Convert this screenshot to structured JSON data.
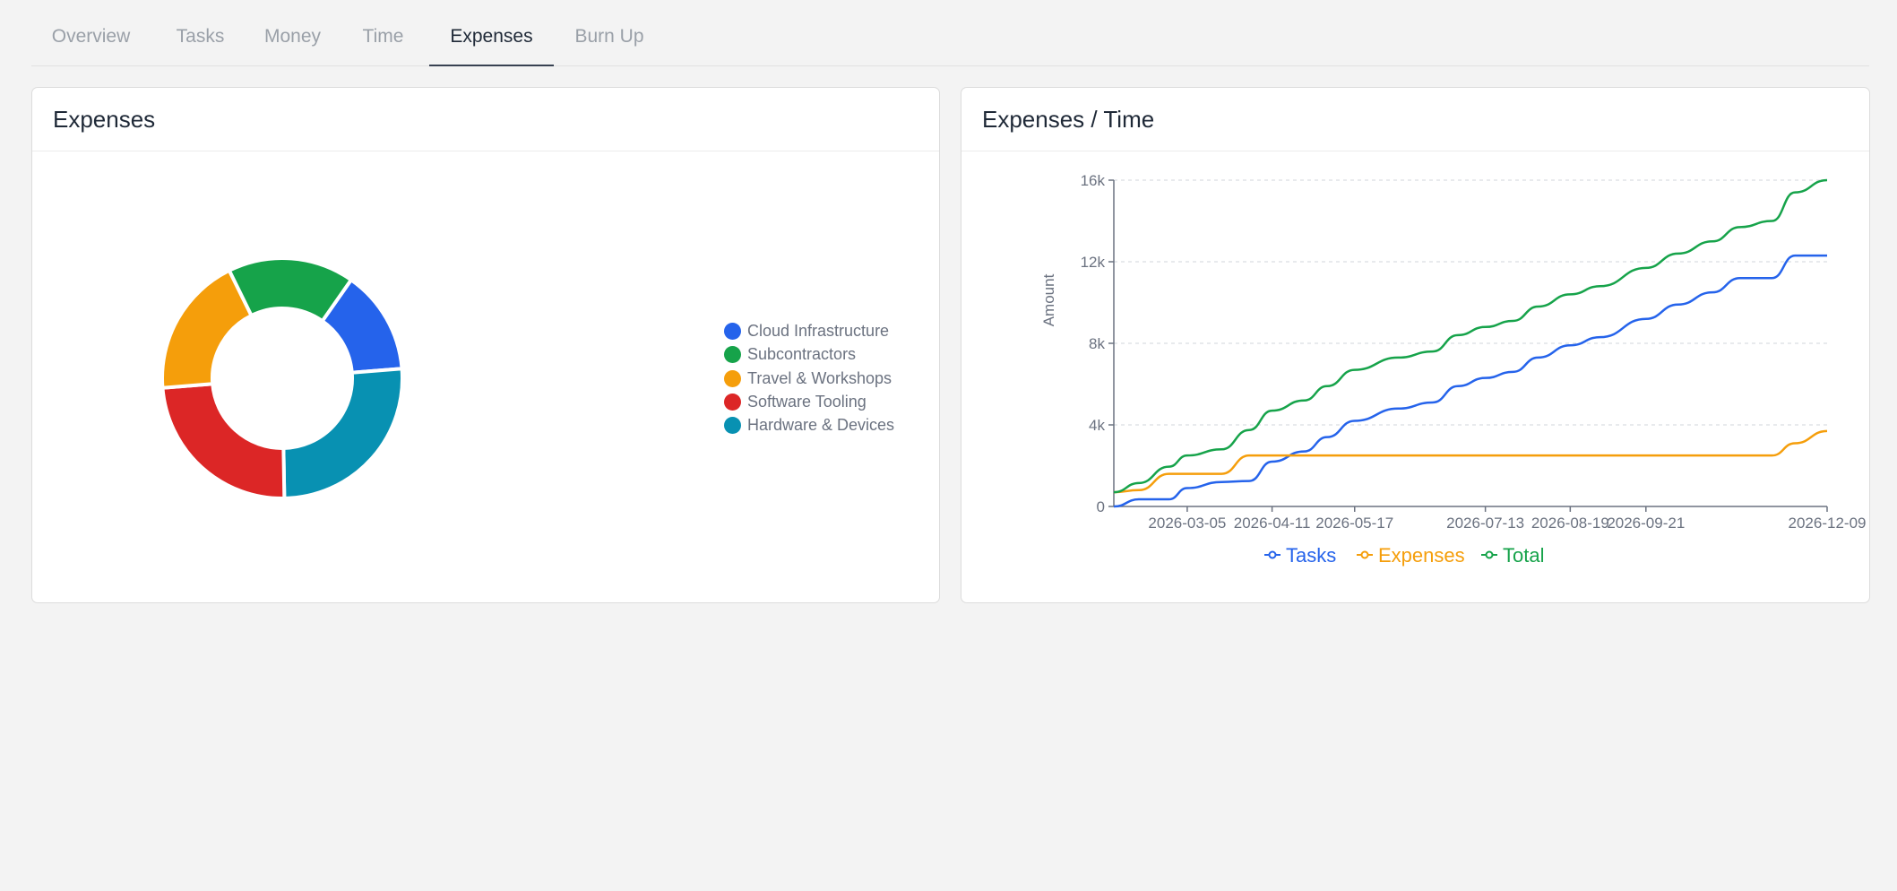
{
  "tabs": [
    {
      "label": "Overview"
    },
    {
      "label": "Tasks"
    },
    {
      "label": "Money"
    },
    {
      "label": "Time"
    },
    {
      "label": "Expenses",
      "active": true
    },
    {
      "label": "Burn Up"
    }
  ],
  "expenses_card": {
    "title": "Expenses"
  },
  "time_card": {
    "title": "Expenses / Time"
  },
  "chart_data": [
    {
      "type": "pie",
      "variant": "doughnut",
      "title": "",
      "legend_position": "right",
      "categories": [
        "Cloud Infrastructure",
        "Subcontractors",
        "Travel & Workshops",
        "Software Tooling",
        "Hardware & Devices"
      ],
      "values": [
        14,
        17,
        19,
        24,
        26
      ],
      "colors": [
        "#2563eb",
        "#16a34a",
        "#f59e0b",
        "#dc2626",
        "#0891b2"
      ]
    },
    {
      "type": "line",
      "title": "",
      "xlabel": "",
      "ylabel": "Amount",
      "x_ticks": [
        "2026-03-05",
        "2026-04-11",
        "2026-05-17",
        "2026-07-13",
        "2026-08-19",
        "2026-09-21",
        "2026-12-09"
      ],
      "y_ticks": [
        "0",
        "4k",
        "8k",
        "12k",
        "16k"
      ],
      "ylim": [
        0,
        16000
      ],
      "grid": true,
      "legend_position": "bottom",
      "x": [
        "2026-02-01",
        "2026-02-12",
        "2026-02-25",
        "2026-03-05",
        "2026-03-20",
        "2026-04-01",
        "2026-04-11",
        "2026-04-25",
        "2026-05-05",
        "2026-05-17",
        "2026-06-05",
        "2026-06-20",
        "2026-07-01",
        "2026-07-13",
        "2026-07-25",
        "2026-08-05",
        "2026-08-19",
        "2026-09-01",
        "2026-09-21",
        "2026-10-05",
        "2026-10-20",
        "2026-11-01",
        "2026-11-15",
        "2026-11-25",
        "2026-12-09"
      ],
      "series": [
        {
          "name": "Tasks",
          "color": "#2563eb",
          "values": [
            0,
            350,
            350,
            900,
            1200,
            1250,
            2200,
            2700,
            3400,
            4200,
            4800,
            5100,
            5900,
            6300,
            6600,
            7300,
            7900,
            8300,
            9200,
            9900,
            10500,
            11200,
            11200,
            12300,
            12300
          ]
        },
        {
          "name": "Expenses",
          "color": "#f59e0b",
          "values": [
            700,
            800,
            1600,
            1600,
            1600,
            2500,
            2500,
            2500,
            2500,
            2500,
            2500,
            2500,
            2500,
            2500,
            2500,
            2500,
            2500,
            2500,
            2500,
            2500,
            2500,
            2500,
            2500,
            3100,
            3700
          ]
        },
        {
          "name": "Total",
          "color": "#16a34a",
          "values": [
            700,
            1150,
            1950,
            2500,
            2800,
            3750,
            4700,
            5200,
            5900,
            6700,
            7300,
            7600,
            8400,
            8800,
            9100,
            9800,
            10400,
            10800,
            11700,
            12400,
            13000,
            13700,
            14000,
            15400,
            16000
          ]
        }
      ]
    }
  ]
}
